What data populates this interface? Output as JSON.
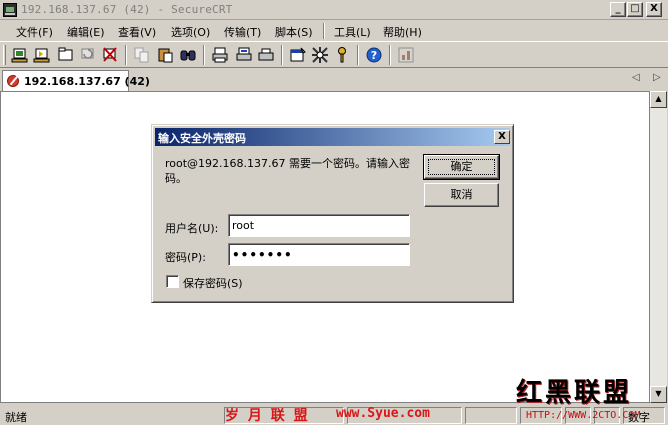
{
  "window": {
    "title": "192.168.137.67 (42) - SecureCRT",
    "minimize": "_",
    "maximize": "□",
    "close": "X"
  },
  "menu": [
    "文件(F)",
    "编辑(E)",
    "查看(V)",
    "选项(O)",
    "传输(T)",
    "脚本(S)",
    "工具(L)",
    "帮助(H)"
  ],
  "toolbar_icons": [
    "connect-icon",
    "quick-connect-icon",
    "connect-in-tab-icon",
    "reconnect-icon",
    "disconnect-icon",
    "copy-icon",
    "paste-icon",
    "find-icon",
    "print-icon",
    "print-selection-icon",
    "print-setup-icon",
    "session-options-icon",
    "global-options-icon",
    "keymap-icon",
    "help-icon",
    "logo-icon"
  ],
  "tab": {
    "label": "192.168.137.67 (42)",
    "prev": "◁",
    "next": "▷"
  },
  "dialog": {
    "title": "输入安全外壳密码",
    "close": "X",
    "message": "root@192.168.137.67 需要一个密码。请输入密码。",
    "ok_label": "确定",
    "cancel_label": "取消",
    "username_label": "用户名(U):",
    "username_value": "root",
    "password_label": "密码(P):",
    "password_value": "•••••••",
    "save_password_label": "保存密码(S)"
  },
  "statusbar": {
    "ready": "就绪",
    "num": "数字"
  },
  "watermarks": {
    "logo": "红黑联盟",
    "site": "HTTP://WWW.2CTO.COM",
    "red_cn": "岁 月 联 盟",
    "red_url": "www.Syue.com"
  }
}
